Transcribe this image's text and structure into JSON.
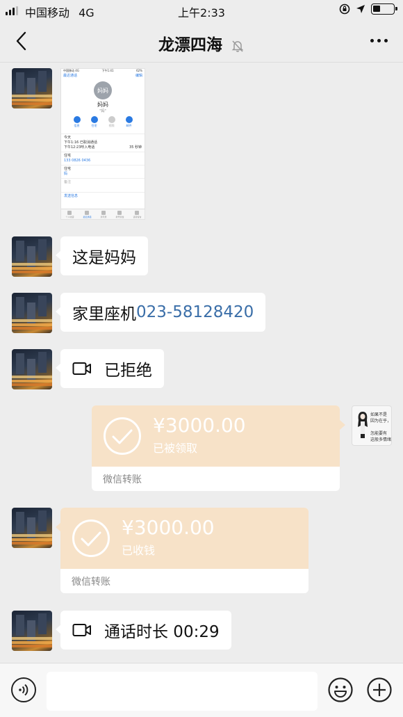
{
  "status_bar": {
    "carrier": "中国移动",
    "network": "4G",
    "time": "上午2:33"
  },
  "nav": {
    "title": "龙漂四海",
    "icons": [
      "back-icon",
      "mute-bell-icon",
      "more-icon"
    ]
  },
  "screenshot_message": {
    "status_left": "中国移动 4G",
    "status_time": "下午1:41",
    "status_battery": "62%",
    "back_label": "最近通话",
    "edit_label": "编辑",
    "avatar_text": "妈妈",
    "contact_name": "妈妈",
    "contact_sub": "\"妈\"",
    "actions": [
      "信息",
      "住宅",
      "视频",
      "邮件"
    ],
    "today_label": "今天",
    "call_rows": [
      "下午1:16  已取消通话",
      "下午12:23呼入电话"
    ],
    "call_duration": "35 秒钟",
    "home_label": "住宅",
    "home_number": "133 0826 0436",
    "home_label2": "住宅",
    "home_value2": "妈",
    "notes_label": "备注",
    "send_message": "发送信息",
    "tabs": [
      "个人收藏",
      "最近通话",
      "通讯录",
      "拨号键盘",
      "语音留言"
    ]
  },
  "messages": [
    {
      "text": "这是妈妈"
    },
    {
      "text": "家里座机",
      "link": "023-58128420"
    },
    {
      "text": "已拒绝",
      "icon": "video-call-icon"
    },
    {
      "text": "通话时长 00:29",
      "icon": "video-call-icon"
    }
  ],
  "my_avatar_text": "如果不是\n因为在乎，\n\n怎能要有\n这般多情绪",
  "transfers": [
    {
      "amount": "¥3000.00",
      "status": "已被领取",
      "footer": "微信转账",
      "side": "right"
    },
    {
      "amount": "¥3000.00",
      "status": "已收钱",
      "footer": "微信转账",
      "side": "left"
    }
  ],
  "input_bar": {
    "icons": [
      "voice-icon",
      "emoji-icon",
      "plus-icon"
    ]
  },
  "colors": {
    "background": "#ededed",
    "bubble": "#ffffff",
    "transfer_received": "#f7e2c8",
    "link": "#3a6ea8"
  }
}
